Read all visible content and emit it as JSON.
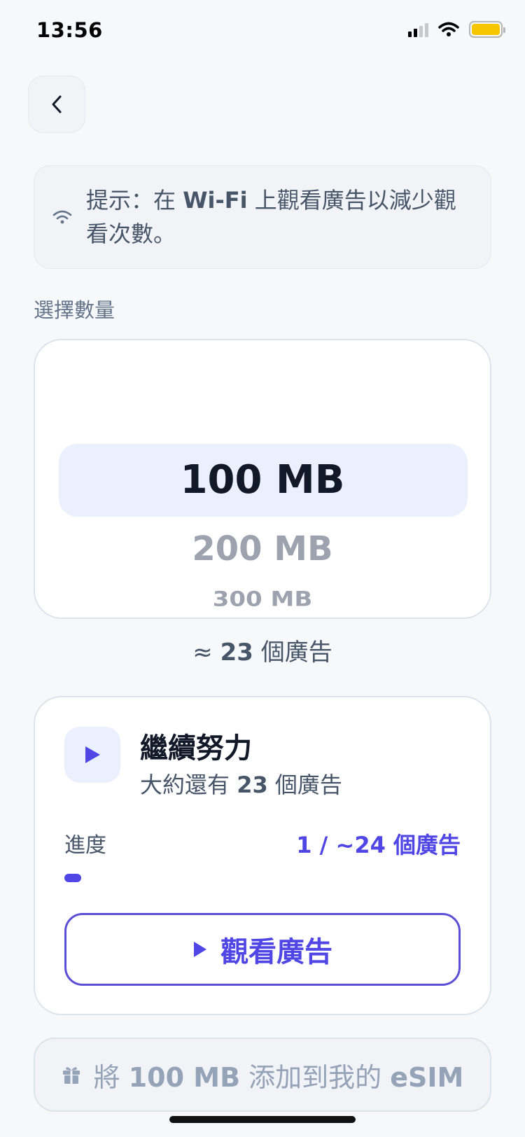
{
  "status_bar": {
    "time": "13:56"
  },
  "tip": {
    "prefix": "提示：在 ",
    "bold": "Wi-Fi",
    "suffix": " 上觀看廣告以減少觀看次數。"
  },
  "section_label": "選擇數量",
  "picker": {
    "options": [
      "100 MB",
      "200 MB",
      "300 MB"
    ],
    "selected": "100 MB"
  },
  "estimate": {
    "prefix": "≈ ",
    "count": "23",
    "suffix": " 個廣告"
  },
  "progress_card": {
    "title": "繼續努力",
    "subtitle_prefix": "大約還有 ",
    "subtitle_count": "23",
    "subtitle_suffix": " 個廣告",
    "progress_label": "進度",
    "progress_count": "1 / ~24 個廣告",
    "progress_fraction": 0.042,
    "watch_button_label": "觀看廣告"
  },
  "add_button": {
    "prefix": "將 ",
    "amount": "100 MB",
    "middle": " 添加到我的 ",
    "target": "eSIM"
  },
  "colors": {
    "accent": "#4f46e5",
    "selected_bg": "#eaf0fd",
    "battery": "#f7c500"
  },
  "icons": [
    "chevron-left-icon",
    "wifi-icon",
    "play-icon",
    "gift-icon"
  ]
}
